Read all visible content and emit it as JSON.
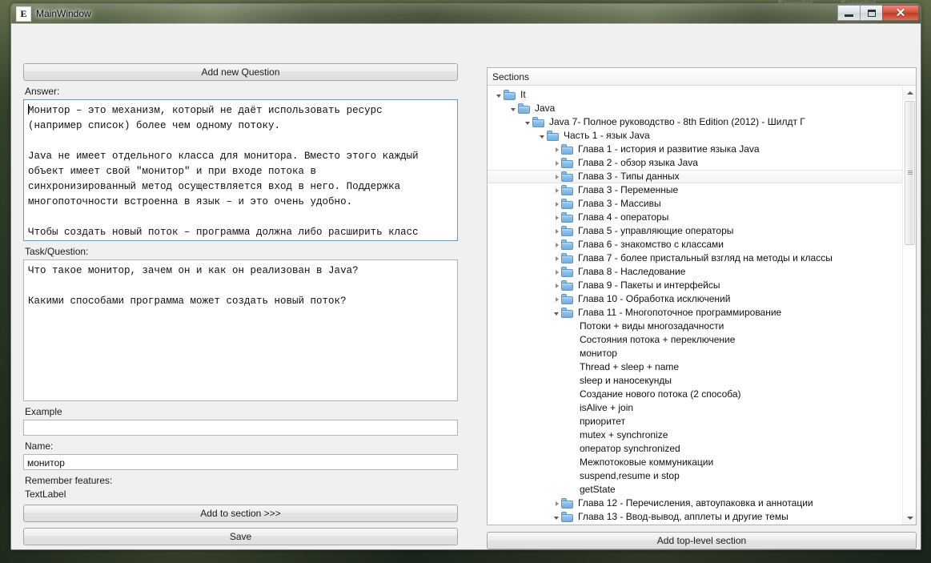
{
  "desktop": {
    "taskbar_ghost": [
      "Essential...",
      "Essential..."
    ]
  },
  "window": {
    "title": "MainWindow",
    "icon": "app-icon",
    "minimize_label": "–",
    "maximize_label": "□",
    "close_label": "✕"
  },
  "left": {
    "add_question_button": "Add new Question",
    "answer_label": "Answer:",
    "answer_value": "Монитор – это механизм, который не даёт использовать ресурс\n(например список) более чем одному потоку.\n\nJava не имеет отдельного класса для монитора. Вместо этого каждый\nобъект имеет свой \"монитор\" и при входе потока в\nсинхронизированный метод осуществляется вход в него. Поддержка\nмногопоточности встроенна в язык – и это очень удобно.\n\nЧтобы создать новый поток – программа должна либо расширить класс\nThread, либо реализовать интерфейс Runnable.",
    "task_label": "Task/Question:",
    "task_value": "Что такое монитор, зачем он и как он реализован в Java?\n\nКакими способами программа может создать новый поток?",
    "example_label": "Example",
    "example_value": "",
    "name_label": "Name:",
    "name_value": "монитор",
    "remember_label": "Remember features:",
    "remember_value": "TextLabel",
    "add_to_section_button": "Add to section >>>",
    "save_button": "Save"
  },
  "right": {
    "sections_header": "Sections",
    "add_top_level_button": "Add top-level section",
    "scrollbar": {
      "up_arrow": "▲",
      "down_arrow": "▼"
    },
    "tree": [
      {
        "label": "It",
        "depth": 0,
        "state": "expanded",
        "folder": true,
        "selected": false
      },
      {
        "label": "Java",
        "depth": 1,
        "state": "expanded",
        "folder": true,
        "selected": false
      },
      {
        "label": "Java 7- Полное руководство - 8th Edition (2012) - Шилдт Г",
        "depth": 2,
        "state": "expanded",
        "folder": true,
        "selected": false
      },
      {
        "label": "Часть 1 - язык Java",
        "depth": 3,
        "state": "expanded",
        "folder": true,
        "selected": false
      },
      {
        "label": "Глава 1 - история и развитие языка Java",
        "depth": 4,
        "state": "collapsed",
        "folder": true,
        "selected": false
      },
      {
        "label": "Глава 2 - обзор языка Java",
        "depth": 4,
        "state": "collapsed",
        "folder": true,
        "selected": false
      },
      {
        "label": "Глава 3 - Типы данных",
        "depth": 4,
        "state": "collapsed",
        "folder": true,
        "selected": true
      },
      {
        "label": "Глава 3 - Переменные",
        "depth": 4,
        "state": "collapsed",
        "folder": true,
        "selected": false
      },
      {
        "label": "Глава 3 - Массивы",
        "depth": 4,
        "state": "collapsed",
        "folder": true,
        "selected": false
      },
      {
        "label": "Глава 4 - операторы",
        "depth": 4,
        "state": "collapsed",
        "folder": true,
        "selected": false
      },
      {
        "label": "Глава 5 - управляющие операторы",
        "depth": 4,
        "state": "collapsed",
        "folder": true,
        "selected": false
      },
      {
        "label": "Глава 6 - знакомство с классами",
        "depth": 4,
        "state": "collapsed",
        "folder": true,
        "selected": false
      },
      {
        "label": "Глава 7 - более пристальный взгляд на методы и классы",
        "depth": 4,
        "state": "collapsed",
        "folder": true,
        "selected": false
      },
      {
        "label": "Глава 8 - Наследование",
        "depth": 4,
        "state": "collapsed",
        "folder": true,
        "selected": false
      },
      {
        "label": "Глава 9 - Пакеты и интерфейсы",
        "depth": 4,
        "state": "collapsed",
        "folder": true,
        "selected": false
      },
      {
        "label": "Глава 10 - Обработка исключений",
        "depth": 4,
        "state": "collapsed",
        "folder": true,
        "selected": false
      },
      {
        "label": "Глава 11 - Многопоточное программирование",
        "depth": 4,
        "state": "expanded",
        "folder": true,
        "selected": false
      },
      {
        "label": "Потоки + виды многозадачности",
        "depth": 5,
        "state": "leaf",
        "folder": false,
        "selected": false
      },
      {
        "label": "Состояния потока + переключение",
        "depth": 5,
        "state": "leaf",
        "folder": false,
        "selected": false
      },
      {
        "label": "монитор",
        "depth": 5,
        "state": "leaf",
        "folder": false,
        "selected": false
      },
      {
        "label": "Thread + sleep + name",
        "depth": 5,
        "state": "leaf",
        "folder": false,
        "selected": false
      },
      {
        "label": "sleep и наносекунды",
        "depth": 5,
        "state": "leaf",
        "folder": false,
        "selected": false
      },
      {
        "label": "Создание нового потока (2 способа)",
        "depth": 5,
        "state": "leaf",
        "folder": false,
        "selected": false
      },
      {
        "label": "isAlive + join",
        "depth": 5,
        "state": "leaf",
        "folder": false,
        "selected": false
      },
      {
        "label": "приоритет",
        "depth": 5,
        "state": "leaf",
        "folder": false,
        "selected": false
      },
      {
        "label": "mutex + synchronize",
        "depth": 5,
        "state": "leaf",
        "folder": false,
        "selected": false
      },
      {
        "label": "оператор synchronized",
        "depth": 5,
        "state": "leaf",
        "folder": false,
        "selected": false
      },
      {
        "label": "Межпотоковые коммуникации",
        "depth": 5,
        "state": "leaf",
        "folder": false,
        "selected": false
      },
      {
        "label": "suspend,resume и stop",
        "depth": 5,
        "state": "leaf",
        "folder": false,
        "selected": false
      },
      {
        "label": "getState",
        "depth": 5,
        "state": "leaf",
        "folder": false,
        "selected": false
      },
      {
        "label": "Глава 12 - Перечисления, автоупаковка и аннотации",
        "depth": 4,
        "state": "collapsed",
        "folder": true,
        "selected": false
      },
      {
        "label": "Глава 13 - Ввод-вывод, апплеты и другие темы",
        "depth": 4,
        "state": "expanded",
        "folder": true,
        "selected": false
      }
    ]
  }
}
